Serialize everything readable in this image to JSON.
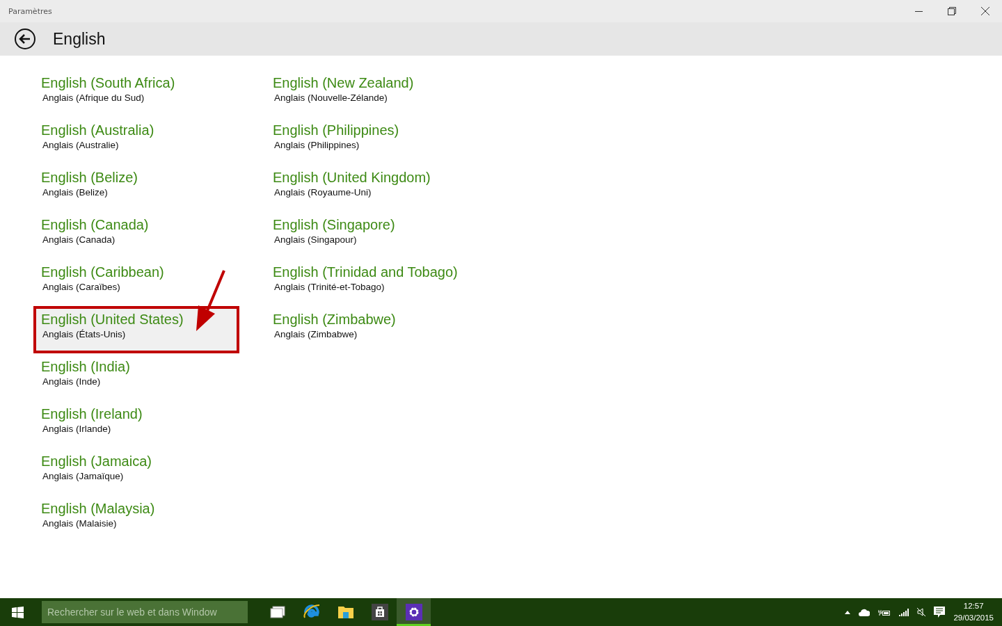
{
  "window": {
    "title": "Paramètres"
  },
  "header": {
    "title": "English"
  },
  "languages": [
    {
      "name": "English (South Africa)",
      "subtitle": "Anglais (Afrique du Sud)",
      "selected": false,
      "annotated": false
    },
    {
      "name": "English (Australia)",
      "subtitle": "Anglais (Australie)",
      "selected": false,
      "annotated": false
    },
    {
      "name": "English (Belize)",
      "subtitle": "Anglais (Belize)",
      "selected": false,
      "annotated": false
    },
    {
      "name": "English (Canada)",
      "subtitle": "Anglais (Canada)",
      "selected": false,
      "annotated": false
    },
    {
      "name": "English (Caribbean)",
      "subtitle": "Anglais (Caraïbes)",
      "selected": false,
      "annotated": false
    },
    {
      "name": "English (United States)",
      "subtitle": "Anglais (États-Unis)",
      "selected": true,
      "annotated": true
    },
    {
      "name": "English (India)",
      "subtitle": "Anglais (Inde)",
      "selected": false,
      "annotated": false
    },
    {
      "name": "English (Ireland)",
      "subtitle": "Anglais (Irlande)",
      "selected": false,
      "annotated": false
    },
    {
      "name": "English (Jamaica)",
      "subtitle": "Anglais (Jamaïque)",
      "selected": false,
      "annotated": false
    },
    {
      "name": "English (Malaysia)",
      "subtitle": "Anglais (Malaisie)",
      "selected": false,
      "annotated": false
    },
    {
      "name": "English (New Zealand)",
      "subtitle": "Anglais (Nouvelle-Zélande)",
      "selected": false,
      "annotated": false
    },
    {
      "name": "English (Philippines)",
      "subtitle": "Anglais (Philippines)",
      "selected": false,
      "annotated": false
    },
    {
      "name": "English (United Kingdom)",
      "subtitle": "Anglais (Royaume-Uni)",
      "selected": false,
      "annotated": false
    },
    {
      "name": "English (Singapore)",
      "subtitle": "Anglais (Singapour)",
      "selected": false,
      "annotated": false
    },
    {
      "name": "English (Trinidad and Tobago)",
      "subtitle": "Anglais (Trinité-et-Tobago)",
      "selected": false,
      "annotated": false
    },
    {
      "name": "English (Zimbabwe)",
      "subtitle": "Anglais (Zimbabwe)",
      "selected": false,
      "annotated": false
    }
  ],
  "taskbar": {
    "search": {
      "placeholder": "Rechercher sur le web et dans Window"
    },
    "apps": [
      {
        "kind": "taskview",
        "selected": false
      },
      {
        "kind": "browser",
        "selected": false
      },
      {
        "kind": "explorer",
        "selected": false
      },
      {
        "kind": "store",
        "selected": false
      },
      {
        "kind": "settings",
        "selected": true
      }
    ],
    "time": "12:57",
    "date": "29/03/2015"
  }
}
